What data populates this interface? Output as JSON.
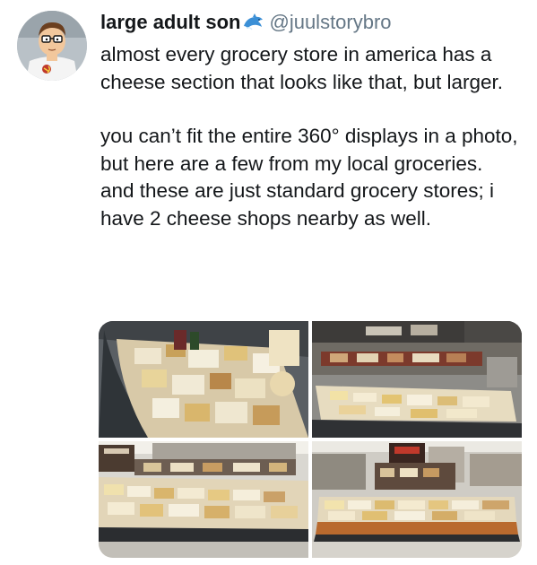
{
  "user": {
    "display_name": "large adult son",
    "name_emoji": "dolphin-icon",
    "handle": "@juulstorybro"
  },
  "tweet": {
    "paragraphs": [
      "almost every grocery store in america has a cheese section that looks like that, but larger.",
      "you can’t fit the entire 360° displays in a photo, but here are a few from my local groceries. and these are just standard grocery stores; i have 2 cheese shops nearby as well."
    ]
  },
  "media": {
    "photos": [
      {
        "subject": "cheese-display-closeup"
      },
      {
        "subject": "cheese-island-deli"
      },
      {
        "subject": "cheese-island-aisle"
      },
      {
        "subject": "cheese-island-wood-trim"
      }
    ]
  },
  "colors": {
    "text": "#14171a",
    "secondary": "#657786",
    "verified_emoji": "#3b8fd6"
  }
}
